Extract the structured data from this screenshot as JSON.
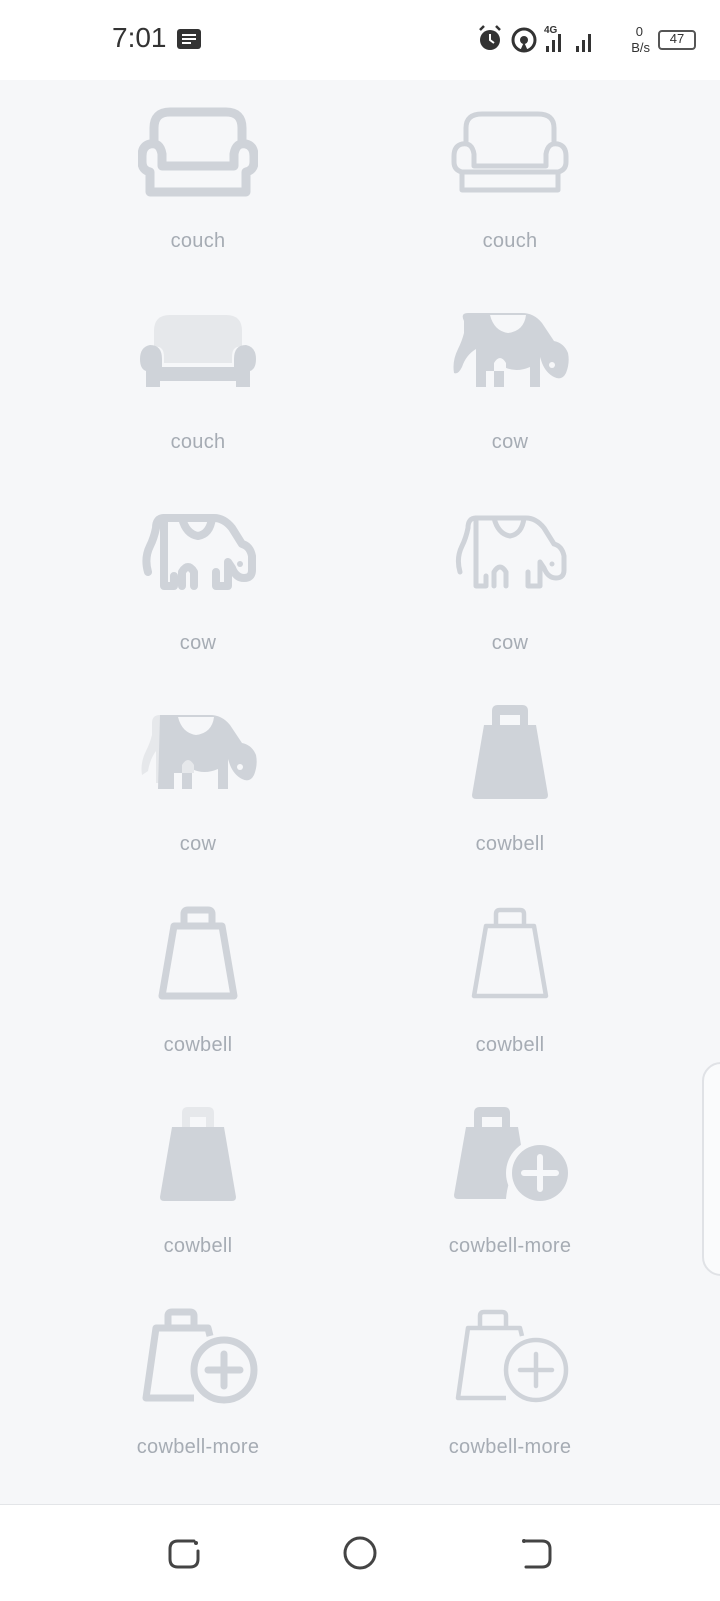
{
  "status_bar": {
    "time": "7:01",
    "network": "4G",
    "speed_value": "0",
    "speed_unit": "B/s",
    "battery": "47",
    "icons": [
      "message-icon",
      "alarm-icon",
      "hotspot-icon",
      "signal-icon",
      "battery-icon"
    ]
  },
  "icons": [
    {
      "label": "couch",
      "icon": "couch-regular-icon"
    },
    {
      "label": "couch",
      "icon": "couch-light-icon"
    },
    {
      "label": "couch",
      "icon": "couch-duotone-icon"
    },
    {
      "label": "cow",
      "icon": "cow-solid-icon"
    },
    {
      "label": "cow",
      "icon": "cow-regular-icon"
    },
    {
      "label": "cow",
      "icon": "cow-light-icon"
    },
    {
      "label": "cow",
      "icon": "cow-duotone-icon"
    },
    {
      "label": "cowbell",
      "icon": "cowbell-solid-icon"
    },
    {
      "label": "cowbell",
      "icon": "cowbell-regular-icon"
    },
    {
      "label": "cowbell",
      "icon": "cowbell-light-icon"
    },
    {
      "label": "cowbell",
      "icon": "cowbell-duotone-icon"
    },
    {
      "label": "cowbell-more",
      "icon": "cowbell-more-solid-icon"
    },
    {
      "label": "cowbell-more",
      "icon": "cowbell-more-regular-icon"
    },
    {
      "label": "cowbell-more",
      "icon": "cowbell-more-light-icon"
    }
  ],
  "nav_bar": {
    "buttons": [
      "recents-button",
      "home-button",
      "back-button"
    ]
  },
  "colors": {
    "icon": "#cfd3d9",
    "icon_light": "#e6e8eb",
    "label": "#a6acb4",
    "background": "#f6f7f9"
  }
}
